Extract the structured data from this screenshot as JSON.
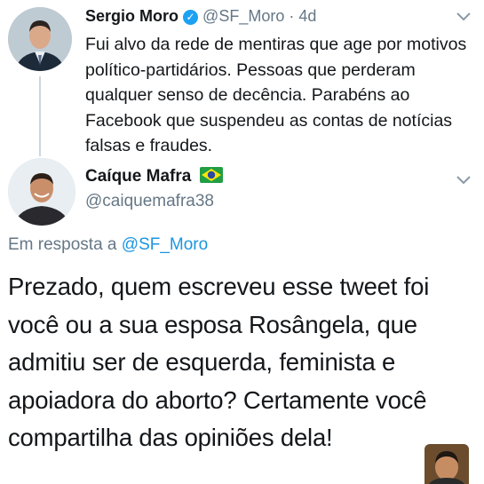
{
  "tweet1": {
    "author_name": "Sergio Moro",
    "handle": "@SF_Moro",
    "separator": "·",
    "time": "4d",
    "text": "Fui alvo da rede de mentiras que age por motivos político-partidários. Pessoas que perderam qualquer senso de decência. Parabéns ao Facebook que suspendeu as contas de notícias falsas e fraudes."
  },
  "tweet2": {
    "author_name": "Caíque Mafra",
    "handle": "@caiquemafra38",
    "reply_prefix": "Em resposta a",
    "reply_to": "@SF_Moro",
    "text": "Prezado, quem escreveu esse tweet foi você ou a sua esposa Rosângela, que admitiu ser de esquerda, feminista e apoiadora do aborto? Certamente você compartilha das opiniões dela!"
  },
  "icons": {
    "verified": "verified-badge-icon",
    "menu": "chevron-down-icon",
    "flag": "brazil-flag-icon"
  },
  "colors": {
    "link": "#1b95e0",
    "verified": "#1da1f2",
    "secondary_text": "#657786",
    "thread_line": "#ccd6dd"
  }
}
